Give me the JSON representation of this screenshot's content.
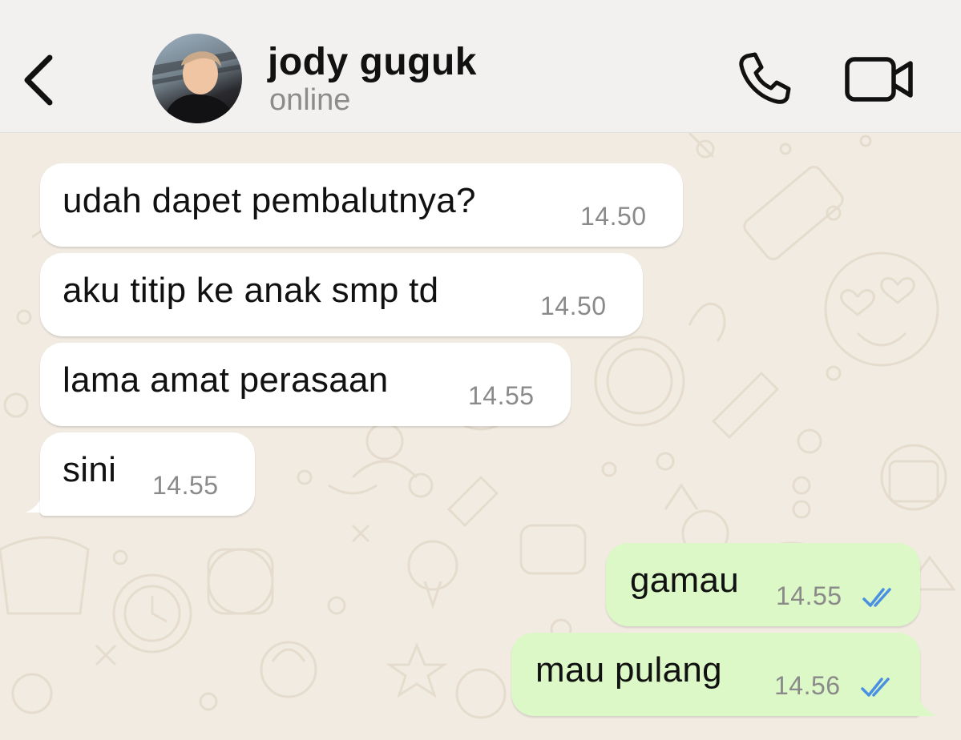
{
  "header": {
    "contact_name": "jody guguk",
    "status": "online",
    "icons": {
      "back": "chevron-left-icon",
      "call": "phone-icon",
      "video": "video-camera-icon"
    }
  },
  "messages": [
    {
      "direction": "incoming",
      "text": "udah dapet pembalutnya?",
      "time": "14.50"
    },
    {
      "direction": "incoming",
      "text": "aku titip ke anak smp td",
      "time": "14.50"
    },
    {
      "direction": "incoming",
      "text": "lama amat perasaan",
      "time": "14.55"
    },
    {
      "direction": "incoming",
      "text": "sini",
      "time": "14.55"
    },
    {
      "direction": "outgoing",
      "text": "gamau",
      "time": "14.55",
      "status": "read"
    },
    {
      "direction": "outgoing",
      "text": "mau pulang",
      "time": "14.56",
      "status": "read"
    }
  ],
  "colors": {
    "wallpaper": "#f1ebe2",
    "incoming_bubble": "#ffffff",
    "outgoing_bubble": "#dcf8c6",
    "read_ticks": "#4a90e2",
    "header_bg": "#f2f1ef"
  }
}
